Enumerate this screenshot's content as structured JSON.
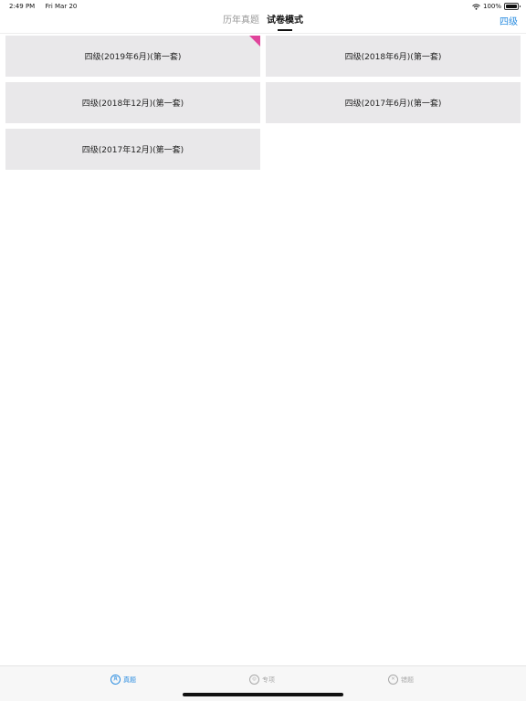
{
  "status_bar": {
    "time": "2:49 PM",
    "date": "Fri Mar 20",
    "battery": "100%"
  },
  "header": {
    "tabs": [
      {
        "label": "历年真题",
        "active": false
      },
      {
        "label": "试卷模式",
        "active": true
      }
    ],
    "level_label": "四级"
  },
  "papers": [
    {
      "title": "四级(2019年6月)(第一套)",
      "badge": true
    },
    {
      "title": "四级(2018年6月)(第一套)",
      "badge": false
    },
    {
      "title": "四级(2018年12月)(第一套)",
      "badge": false
    },
    {
      "title": "四级(2017年6月)(第一套)",
      "badge": false
    },
    {
      "title": "四级(2017年12月)(第一套)",
      "badge": false
    }
  ],
  "tab_bar": {
    "items": [
      {
        "label": "真题",
        "icon": "book-icon",
        "glyph": "真",
        "selected": true
      },
      {
        "label": "专项",
        "icon": "target-icon",
        "glyph": "◎",
        "selected": false
      },
      {
        "label": "错题",
        "icon": "wrong-icon",
        "glyph": "✕",
        "selected": false
      }
    ]
  },
  "colors": {
    "accent": "#2b8de0",
    "badge": "#e0449b",
    "card_bg": "#e9e8ea"
  }
}
